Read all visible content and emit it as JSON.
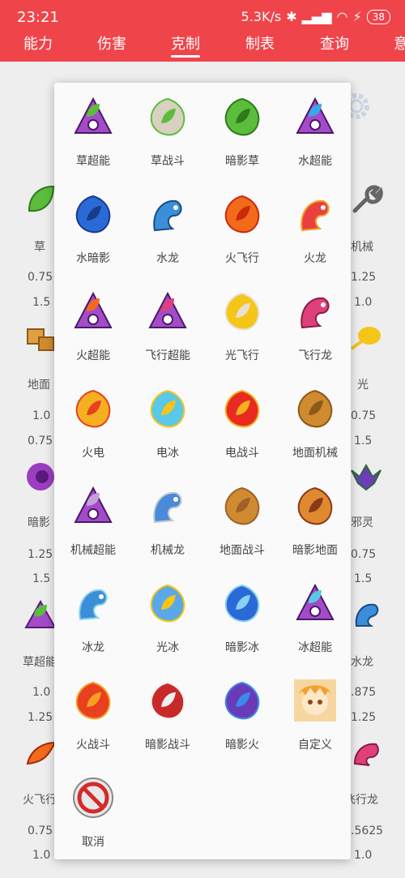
{
  "status_bar": {
    "time": "23:21",
    "speed": "5.3K/s",
    "battery": "38"
  },
  "tabs": [
    {
      "label": "能力"
    },
    {
      "label": "伤害"
    },
    {
      "label": "克制"
    },
    {
      "label": "制表"
    },
    {
      "label": "查询"
    },
    {
      "label": "意"
    }
  ],
  "active_tab": "克制",
  "background": {
    "left_labels": [
      "草",
      "地面",
      "暗影",
      "草超能",
      "火飞行"
    ],
    "left_values": [
      "0.75",
      "1.5",
      "1.0",
      "0.75",
      "1.25",
      "1.5",
      "1.0",
      "1.25",
      "0.75",
      "1.0"
    ],
    "right_labels": [
      "机械",
      "光",
      "邪灵",
      "水龙",
      "飞行龙"
    ],
    "right_values": [
      "1.25",
      "1.0",
      "0.75",
      "1.5",
      "0.75",
      "1.5",
      ".875",
      "1.25",
      ".5625",
      "1.0"
    ]
  },
  "menu": {
    "items": [
      {
        "label": "草超能",
        "icon": "grass-psychic-icon"
      },
      {
        "label": "草战斗",
        "icon": "grass-fight-icon"
      },
      {
        "label": "暗影草",
        "icon": "shadow-grass-icon"
      },
      {
        "label": "水超能",
        "icon": "water-psychic-icon"
      },
      {
        "label": "水暗影",
        "icon": "water-shadow-icon"
      },
      {
        "label": "水龙",
        "icon": "water-dragon-icon"
      },
      {
        "label": "火飞行",
        "icon": "fire-flying-icon"
      },
      {
        "label": "火龙",
        "icon": "fire-dragon-icon"
      },
      {
        "label": "火超能",
        "icon": "fire-psychic-icon"
      },
      {
        "label": "飞行超能",
        "icon": "flying-psychic-icon"
      },
      {
        "label": "光飞行",
        "icon": "light-flying-icon"
      },
      {
        "label": "飞行龙",
        "icon": "flying-dragon-icon"
      },
      {
        "label": "火电",
        "icon": "fire-electric-icon"
      },
      {
        "label": "电冰",
        "icon": "electric-ice-icon"
      },
      {
        "label": "电战斗",
        "icon": "electric-fight-icon"
      },
      {
        "label": "地面机械",
        "icon": "ground-mech-icon"
      },
      {
        "label": "机械超能",
        "icon": "mech-psychic-icon"
      },
      {
        "label": "机械龙",
        "icon": "mech-dragon-icon"
      },
      {
        "label": "地面战斗",
        "icon": "ground-fight-icon"
      },
      {
        "label": "暗影地面",
        "icon": "shadow-ground-icon"
      },
      {
        "label": "冰龙",
        "icon": "ice-dragon-icon"
      },
      {
        "label": "光冰",
        "icon": "light-ice-icon"
      },
      {
        "label": "暗影冰",
        "icon": "shadow-ice-icon"
      },
      {
        "label": "冰超能",
        "icon": "ice-psychic-icon"
      },
      {
        "label": "火战斗",
        "icon": "fire-fight-icon"
      },
      {
        "label": "暗影战斗",
        "icon": "shadow-fight-icon"
      },
      {
        "label": "暗影火",
        "icon": "shadow-fire-icon"
      },
      {
        "label": "自定义",
        "icon": "custom-avatar-icon"
      },
      {
        "label": "取消",
        "icon": "cancel-icon"
      }
    ]
  }
}
